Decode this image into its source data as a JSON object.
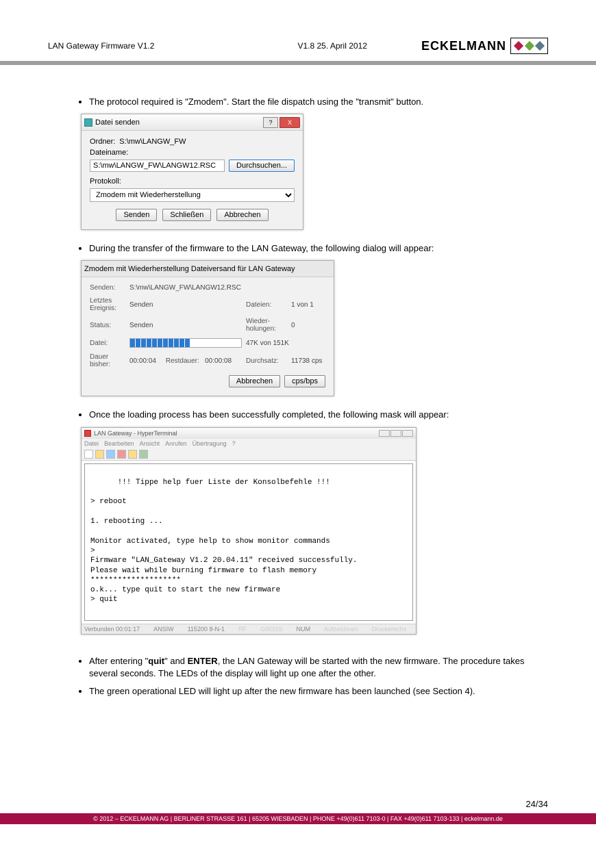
{
  "header": {
    "left": "LAN Gateway Firmware V1.2",
    "mid": "V1.8    25. April 2012",
    "logo_text": "ECKELMANN"
  },
  "bullets": {
    "b1": "The protocol required is \"Zmodem\". Start the file dispatch using the \"transmit\" button.",
    "b2": "During the transfer of the firmware to the LAN Gateway, the following dialog will appear:",
    "b3": "Once the loading process has been successfully completed, the following mask will appear:",
    "b4_prefix": "After entering \"",
    "b4_quit": "quit",
    "b4_mid": "\" and ",
    "b4_enter": "ENTER",
    "b4_suffix": ", the LAN Gateway will be started with the new firmware. The procedure takes several seconds.  The LEDs of the display will light up one after the other.",
    "b5": "The green operational LED will light up after the new firmware has been launched (see Section 4)."
  },
  "dialog1": {
    "title": "Datei senden",
    "ordner_lbl": "Ordner:",
    "ordner_val": "S:\\mw\\LANGW_FW",
    "dateiname_lbl": "Dateiname:",
    "file_val": "S:\\mw\\LANGW_FW\\LANGW12.RSC",
    "browse": "Durchsuchen...",
    "protokoll_lbl": "Protokoll:",
    "protokoll_val": "Zmodem mit Wiederherstellung",
    "senden": "Senden",
    "schliessen": "Schließen",
    "abbrechen": "Abbrechen"
  },
  "dialog2": {
    "title": "Zmodem mit Wiederherstellung Dateiversand für LAN Gateway",
    "senden_lbl": "Senden:",
    "senden_val": "S:\\mw\\LANGW_FW\\LANGW12.RSC",
    "letztes_lbl": "Letztes Ereignis:",
    "letztes_val": "Senden",
    "dateien_lbl": "Dateien:",
    "dateien_val": "1 von 1",
    "status_lbl": "Status:",
    "status_val": "Senden",
    "wieder_lbl": "Wieder-holungen:",
    "wieder_val": "0",
    "datei_lbl": "Datei:",
    "datei_val": "47K von 151K",
    "dauer_lbl": "Dauer bisher:",
    "dauer_val": "00:00:04",
    "restdauer_lbl": "Restdauer:",
    "restdauer_val": "00:00:08",
    "durchsatz_lbl": "Durchsatz:",
    "durchsatz_val": "11738 cps",
    "abbrechen": "Abbrechen",
    "cpsbps": "cps/bps"
  },
  "terminal": {
    "title": "LAN Gateway - HyperTerminal",
    "menu": [
      "Datei",
      "Bearbeiten",
      "Ansicht",
      "Anrufen",
      "Übertragung",
      "?"
    ],
    "body": "\n      !!! Tippe help fuer Liste der Konsolbefehle !!!\n\n> reboot\n\n1. rebooting ...\n\nMonitor activated, type help to show monitor commands\n>\nFirmware \"LAN_Gateway V1.2 20.04.11\" received successfully.\nPlease wait while burning firmware to flash memory\n********************\no.k... type quit to start the new firmware\n> quit",
    "status": [
      "Verbunden 00:01:17",
      "ANSIW",
      "115200 8-N-1",
      "RF",
      "GROSS",
      "NUM",
      "Aufzeichnen",
      "Druckerecho"
    ]
  },
  "page_num": "24/34",
  "footer": "© 2012 – ECKELMANN AG | BERLINER STRASSE 161 | 65205 WIESBADEN | PHONE +49(0)611 7103-0 | FAX +49(0)611 7103-133 | eckelmann.de"
}
